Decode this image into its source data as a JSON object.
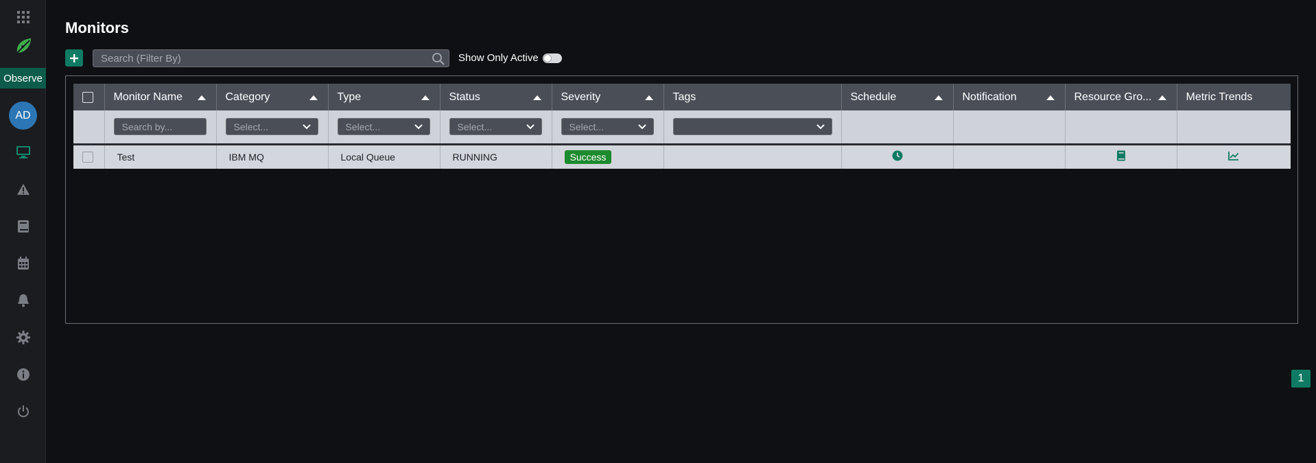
{
  "sidebar": {
    "section_label": "Observe",
    "avatar_initials": "AD",
    "icons": [
      "apps-grid-icon",
      "leaf-logo-icon",
      "monitor-icon",
      "alert-triangle-icon",
      "book-icon",
      "calendar-icon",
      "bell-icon",
      "gear-icon",
      "info-icon",
      "power-icon"
    ]
  },
  "header": {
    "title": "Monitors"
  },
  "toolbar": {
    "search_placeholder": "Search (Filter By)",
    "show_only_active_label": "Show Only Active"
  },
  "table": {
    "columns": [
      {
        "label": "Monitor Name",
        "sortable": true
      },
      {
        "label": "Category",
        "sortable": true
      },
      {
        "label": "Type",
        "sortable": true
      },
      {
        "label": "Status",
        "sortable": true
      },
      {
        "label": "Severity",
        "sortable": true
      },
      {
        "label": "Tags",
        "sortable": false
      },
      {
        "label": "Schedule",
        "sortable": true
      },
      {
        "label": "Notification",
        "sortable": true
      },
      {
        "label": "Resource Gro...",
        "sortable": true
      },
      {
        "label": "Metric Trends",
        "sortable": false
      }
    ],
    "filters": {
      "name_placeholder": "Search by...",
      "category_placeholder": "Select...",
      "type_placeholder": "Select...",
      "status_placeholder": "Select...",
      "severity_placeholder": "Select...",
      "tags_placeholder": ""
    },
    "rows": [
      {
        "name": "Test",
        "category": "IBM MQ",
        "type": "Local Queue",
        "status": "RUNNING",
        "severity": "Success",
        "tags": "",
        "schedule_icon": "clock-icon",
        "resource_group_icon": "book-icon",
        "metric_trends_icon": "line-chart-icon"
      }
    ]
  },
  "pagination": {
    "current_page": "1"
  },
  "colors": {
    "accent": "#0f7b64",
    "success": "#1c8a2d",
    "background": "#0f1013",
    "sidebar": "#1b1c20",
    "header": "#4a4e57"
  }
}
